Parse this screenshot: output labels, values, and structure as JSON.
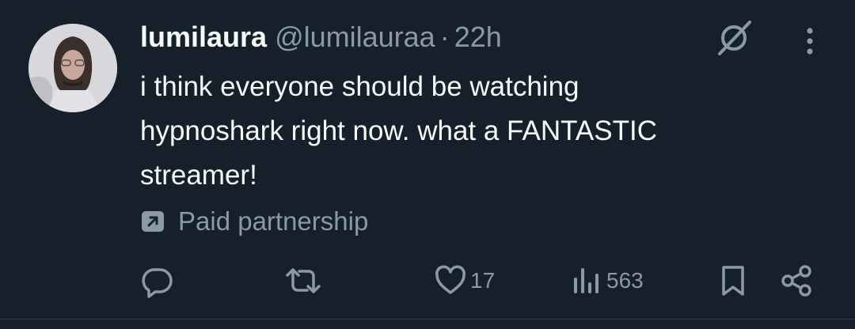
{
  "author": {
    "name": "lumilaura",
    "handle": "@lumilauraa",
    "separator": "·",
    "time": "22h"
  },
  "tweet": {
    "text": "i think everyone should be watching\nhypnoshark right now. what a FANTASTIC\nstreamer!"
  },
  "label": {
    "text": "Paid partnership",
    "icon": "arrow-up-right-box-icon"
  },
  "actions": {
    "reply": {
      "icon": "reply-icon",
      "count": ""
    },
    "retweet": {
      "icon": "retweet-icon",
      "count": ""
    },
    "like": {
      "icon": "heart-icon",
      "count": "17"
    },
    "views": {
      "icon": "views-bar-chart-icon",
      "count": "563"
    },
    "bookmark": {
      "icon": "bookmark-icon"
    },
    "share": {
      "icon": "share-icon"
    }
  },
  "header_icons": {
    "grok": "grok-icon",
    "more": "more-vertical-icon"
  },
  "colors": {
    "background": "#15202b",
    "primary_text": "#f7f9f9",
    "secondary_text": "#8b98a5"
  }
}
